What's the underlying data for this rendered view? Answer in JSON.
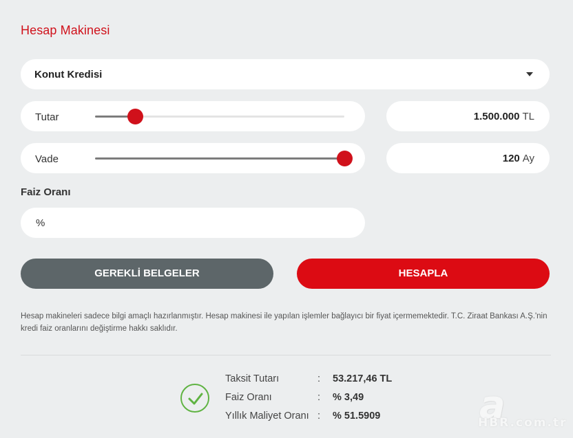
{
  "calculator": {
    "title": "Hesap Makinesi",
    "loan_type": {
      "selected": "Konut Kredisi"
    },
    "amount": {
      "label": "Tutar",
      "value": "1.500.000",
      "unit": "TL",
      "slider_fraction": 0.16
    },
    "term": {
      "label": "Vade",
      "value": "120",
      "unit": "Ay",
      "slider_fraction": 1.0
    },
    "interest": {
      "label": "Faiz Oranı",
      "placeholder": "%"
    },
    "buttons": {
      "documents": "GEREKLİ BELGELER",
      "calculate": "HESAPLA"
    },
    "disclaimer": "Hesap makineleri sadece bilgi amaçlı hazırlanmıştır. Hesap makinesi ile yapılan işlemler bağlayıcı bir fiyat içermemektedir. T.C. Ziraat Bankası A.Ş.'nin kredi faiz oranlarını değiştirme hakkı saklıdır."
  },
  "results": {
    "separator": ":",
    "rows": [
      {
        "label": "Taksit Tutarı",
        "value": "53.217,46 TL"
      },
      {
        "label": "Faiz Oranı",
        "value": "% 3,49"
      },
      {
        "label": "Yıllık Maliyet Oranı",
        "value": "% 51.5909"
      }
    ]
  },
  "watermark": {
    "mark": "a",
    "text": "HBR.com.tr"
  },
  "colors": {
    "accent": "#d0111b",
    "button_secondary": "#5d6669",
    "success": "#5fb342"
  },
  "icons": {
    "dropdown": "caret-down-icon",
    "result": "check-circle-icon"
  }
}
